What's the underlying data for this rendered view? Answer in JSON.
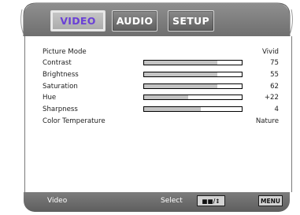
{
  "tabs": [
    {
      "label": "VIDEO",
      "active": true
    },
    {
      "label": "AUDIO",
      "active": false
    },
    {
      "label": "SETUP",
      "active": false
    }
  ],
  "settings": [
    {
      "label": "Picture Mode",
      "value": "Vivid"
    },
    {
      "label": "Contrast",
      "value": "75",
      "level": 0.75
    },
    {
      "label": "Brightness",
      "value": "55",
      "level": 0.75
    },
    {
      "label": "Saturation",
      "value": "62",
      "level": 0.75
    },
    {
      "label": "Hue",
      "value": "+22",
      "level": 0.45
    },
    {
      "label": "Sharpness",
      "value": "4",
      "level": 0.58
    },
    {
      "label": "Color Temperature",
      "value": "Nature"
    }
  ],
  "footer": {
    "section": "Video",
    "hint": "Select",
    "nav_key": "■■/↕",
    "menu_key": "MENU"
  },
  "colors": {
    "frame": "#6f6f6f",
    "active_tab_text": "#6a40d6",
    "bar_fill": "#c4c4c4"
  }
}
